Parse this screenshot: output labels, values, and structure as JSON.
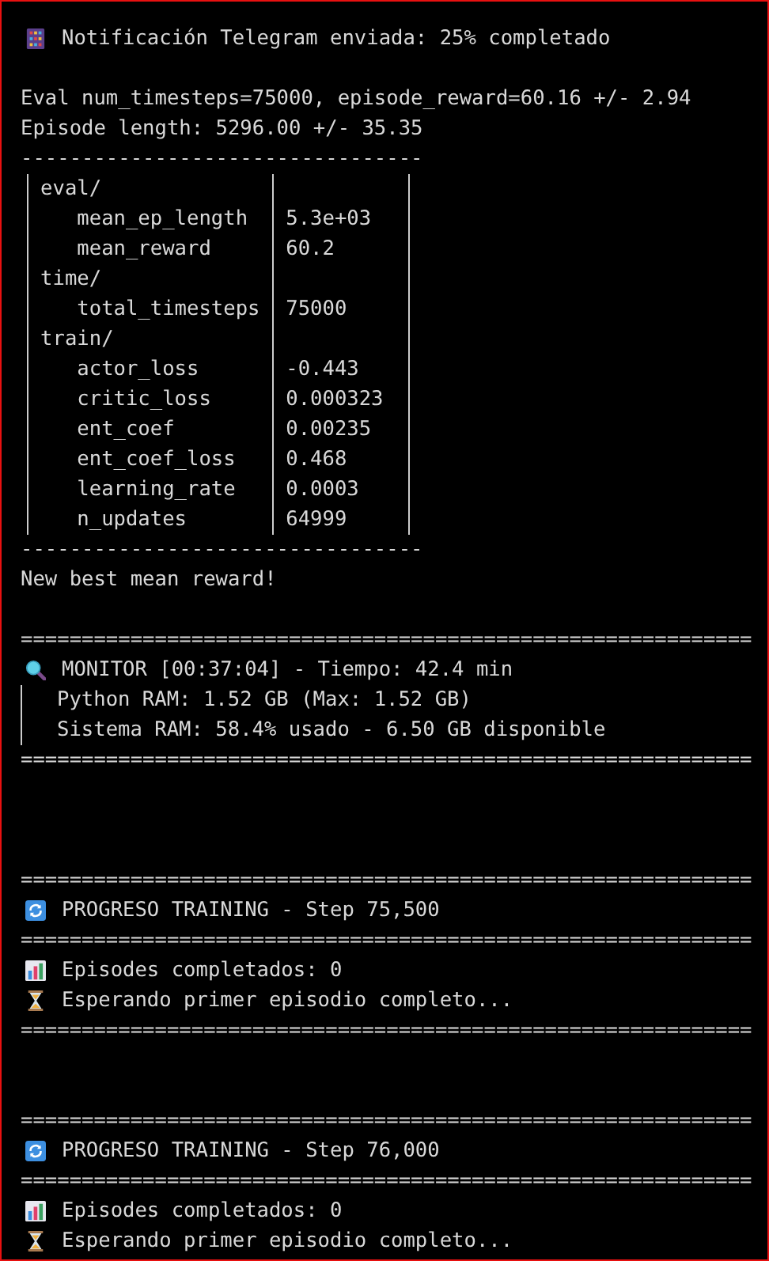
{
  "lines": [
    {
      "kind": "notice",
      "text": "Notificación Telegram enviada: 25% completado"
    },
    {
      "kind": "blank"
    },
    {
      "kind": "text",
      "text": "Eval num_timesteps=75000, episode_reward=60.16 +/- 2.94"
    },
    {
      "kind": "text",
      "text": "Episode length: 5296.00 +/- 35.35"
    },
    {
      "kind": "rule",
      "text": "---------------------------------"
    },
    {
      "kind": "table",
      "sections": [
        {
          "name": "eval/",
          "rows": [
            {
              "key": "mean_ep_length",
              "value": "5.3e+03"
            },
            {
              "key": "mean_reward",
              "value": "60.2"
            }
          ]
        },
        {
          "name": "time/",
          "rows": [
            {
              "key": "total_timesteps",
              "value": "75000"
            }
          ]
        },
        {
          "name": "train/",
          "rows": [
            {
              "key": "actor_loss",
              "value": "-0.443"
            },
            {
              "key": "critic_loss",
              "value": "0.000323"
            },
            {
              "key": "ent_coef",
              "value": "0.00235"
            },
            {
              "key": "ent_coef_loss",
              "value": "0.468"
            },
            {
              "key": "learning_rate",
              "value": "0.0003"
            },
            {
              "key": "n_updates",
              "value": "64999"
            }
          ]
        }
      ]
    },
    {
      "kind": "rule",
      "text": "---------------------------------"
    },
    {
      "kind": "text",
      "text": "New best mean reward!"
    },
    {
      "kind": "blank"
    },
    {
      "kind": "rule",
      "text": "============================================================"
    },
    {
      "kind": "monitor",
      "text": "MONITOR [00:37:04] - Tiempo: 42.4 min"
    },
    {
      "kind": "quote",
      "lines": [
        "Python RAM: 1.52 GB (Max: 1.52 GB)",
        "Sistema RAM: 58.4% usado - 6.50 GB disponible"
      ]
    },
    {
      "kind": "rule",
      "text": "============================================================"
    },
    {
      "kind": "blank"
    },
    {
      "kind": "blank"
    },
    {
      "kind": "blank"
    },
    {
      "kind": "rule",
      "text": "============================================================"
    },
    {
      "kind": "progress",
      "text": "PROGRESO TRAINING - Step 75,500"
    },
    {
      "kind": "rule",
      "text": "============================================================"
    },
    {
      "kind": "episodes",
      "text": "Episodes completados: 0"
    },
    {
      "kind": "waiting",
      "text": "Esperando primer episodio completo..."
    },
    {
      "kind": "rule",
      "text": "============================================================"
    },
    {
      "kind": "blank"
    },
    {
      "kind": "blank"
    },
    {
      "kind": "rule",
      "text": "============================================================"
    },
    {
      "kind": "progress",
      "text": "PROGRESO TRAINING - Step 76,000"
    },
    {
      "kind": "rule",
      "text": "============================================================"
    },
    {
      "kind": "episodes",
      "text": "Episodes completados: 0"
    },
    {
      "kind": "waiting",
      "text": "Esperando primer episodio completo..."
    }
  ]
}
